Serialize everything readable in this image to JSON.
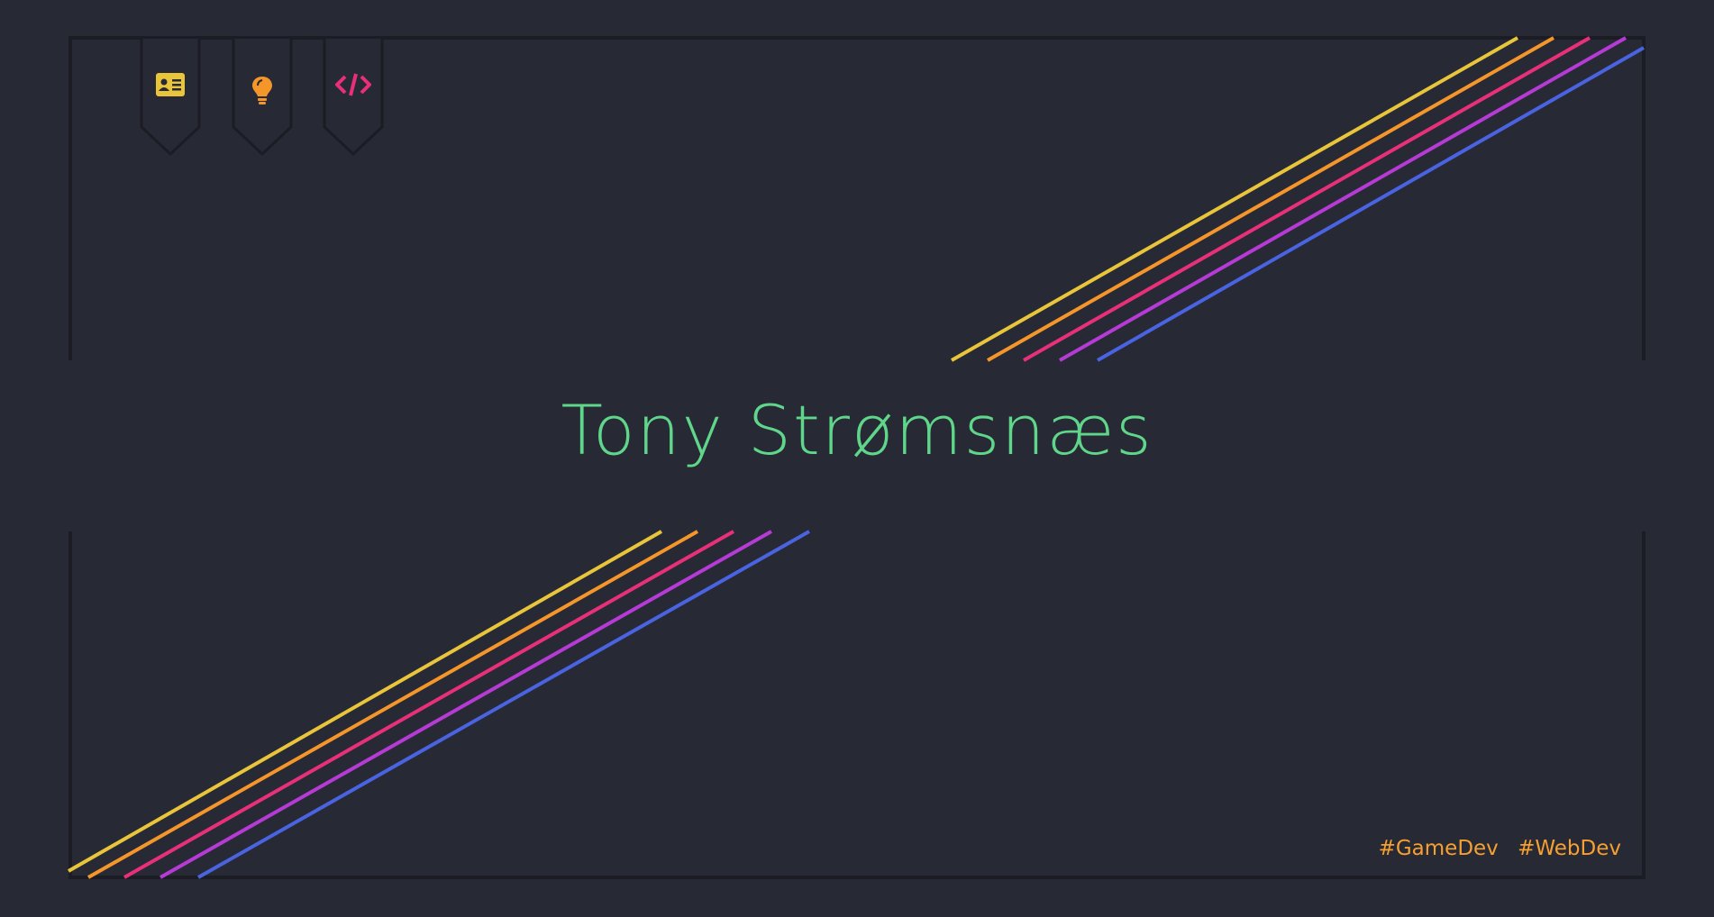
{
  "colors": {
    "background": "#272935",
    "border": "#1b1c24",
    "title": "#5fd68a",
    "tags": "#f5a030",
    "stripes": [
      "#e8c53a",
      "#f5962a",
      "#e8307a",
      "#b63ad4",
      "#4a63e0"
    ]
  },
  "nav": {
    "tabs": [
      {
        "name": "about",
        "icon": "id-card-icon",
        "color": "#e8c53a"
      },
      {
        "name": "ideas",
        "icon": "lightbulb-icon",
        "color": "#f5962a"
      },
      {
        "name": "code",
        "icon": "code-icon",
        "color": "#e8307a"
      }
    ]
  },
  "hero": {
    "title": "Tony Strømsnæs"
  },
  "footer": {
    "tags": [
      "#GameDev",
      "#WebDev"
    ]
  }
}
